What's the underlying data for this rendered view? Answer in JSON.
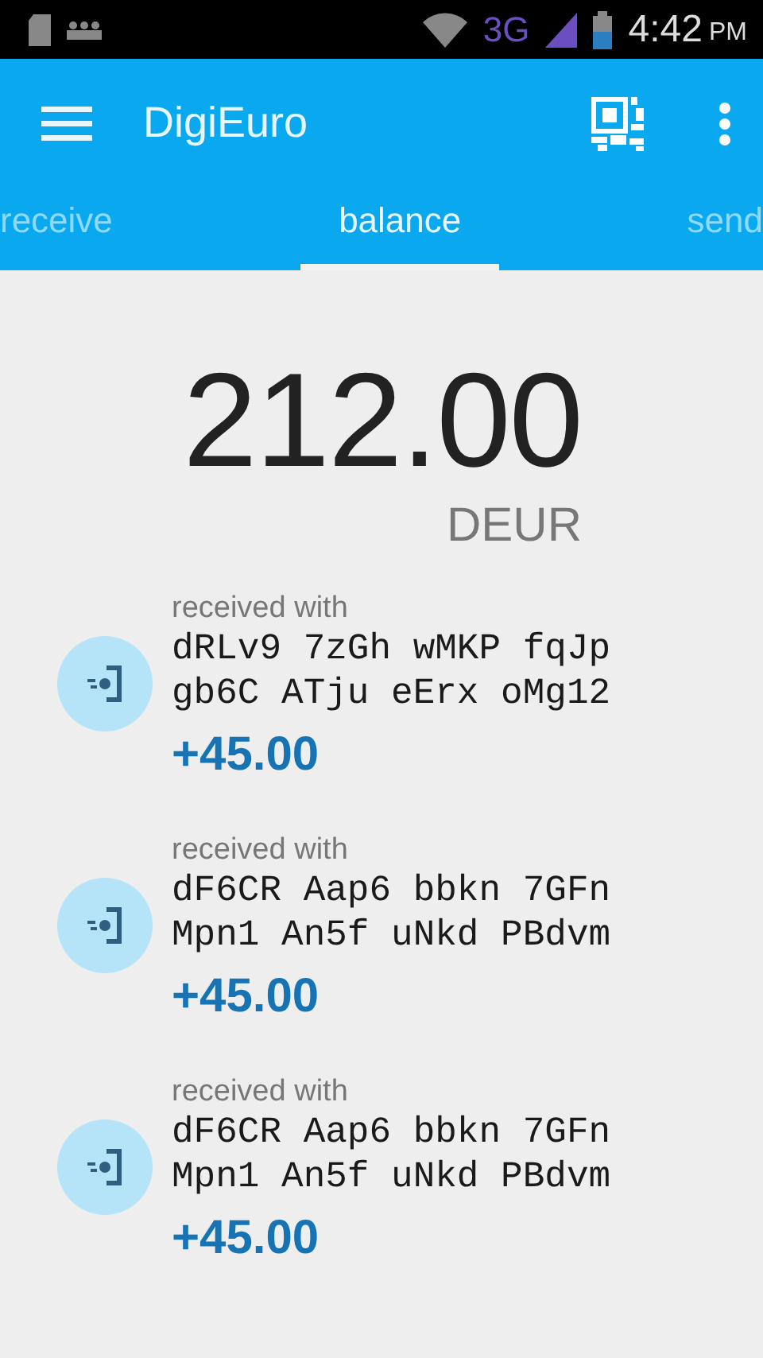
{
  "status_bar": {
    "network": "3G",
    "time": "4:42",
    "meridiem": "PM"
  },
  "app_bar": {
    "title": "DigiEuro"
  },
  "tabs": [
    {
      "label": "receive",
      "selected": false
    },
    {
      "label": "balance",
      "selected": true
    },
    {
      "label": "send",
      "selected": false
    }
  ],
  "balance": {
    "amount": "212.00",
    "currency": "DEUR"
  },
  "transactions": [
    {
      "kind": "received",
      "label": "received with",
      "address_lines": [
        "dRLv9 7zGh wMKP fqJp",
        "gb6C ATju eErx oMg12"
      ],
      "amount": "+45.00"
    },
    {
      "kind": "received",
      "label": "received with",
      "address_lines": [
        "dF6CR Aap6 bbkn 7GFn",
        "Mpn1 An5f uNkd PBdvm"
      ],
      "amount": "+45.00"
    },
    {
      "kind": "received",
      "label": "received with",
      "address_lines": [
        "dF6CR Aap6 bbkn 7GFn",
        "Mpn1 An5f uNkd PBdvm"
      ],
      "amount": "+45.00"
    }
  ]
}
